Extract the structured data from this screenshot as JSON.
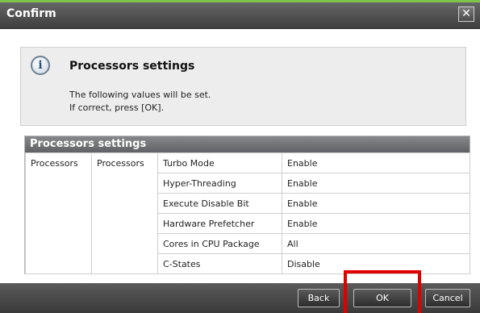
{
  "dialog": {
    "title": "Confirm",
    "close_glyph": "✕"
  },
  "info": {
    "icon": "info-icon",
    "icon_glyph": "i",
    "title": "Processors settings",
    "line1": "The following values will be set.",
    "line2": "If correct, press [OK]."
  },
  "panel": {
    "header": "Processors settings",
    "col1": "Processors",
    "col2": "Processors",
    "rows": [
      {
        "setting": "Turbo Mode",
        "value": "Enable"
      },
      {
        "setting": "Hyper-Threading",
        "value": "Enable"
      },
      {
        "setting": "Execute Disable Bit",
        "value": "Enable"
      },
      {
        "setting": "Hardware Prefetcher",
        "value": "Enable"
      },
      {
        "setting": "Cores in CPU Package",
        "value": "All"
      },
      {
        "setting": "C-States",
        "value": "Disable"
      }
    ]
  },
  "buttons": {
    "back": "Back",
    "ok": "OK",
    "cancel": "Cancel"
  },
  "colors": {
    "highlight": "#e00000",
    "title_accent": "#7fc44a"
  }
}
